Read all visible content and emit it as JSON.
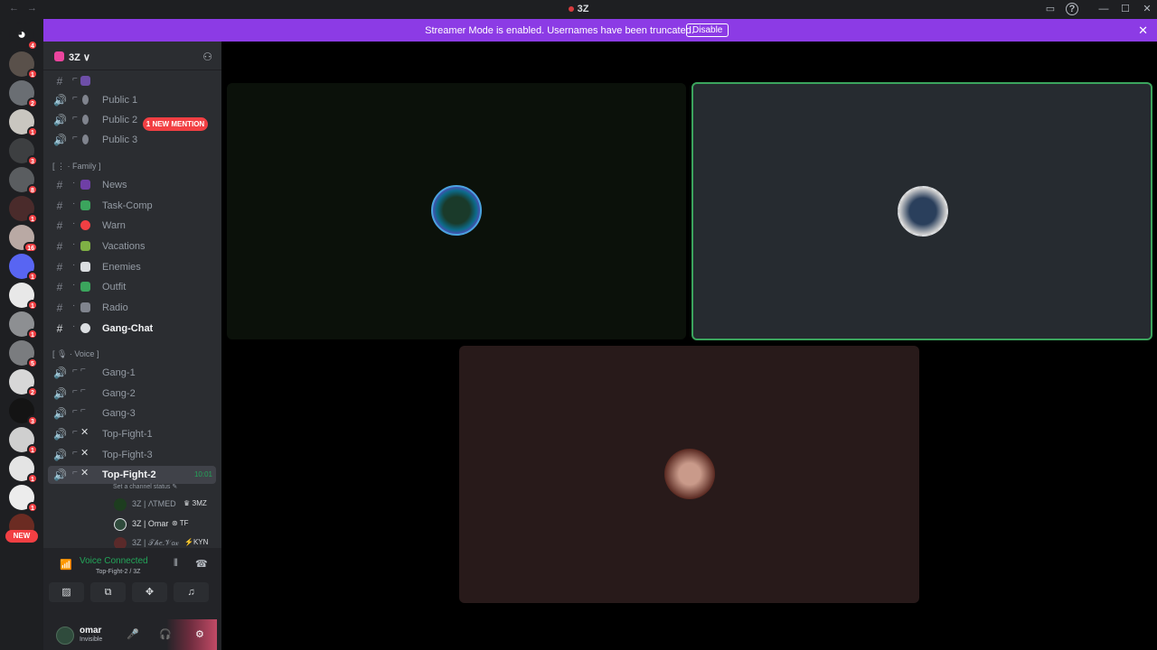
{
  "window": {
    "title": "3Z",
    "back": "←",
    "forward": "→",
    "inbox_glyph": "▭",
    "help_glyph": "?",
    "minimize_glyph": "—",
    "maximize_glyph": "☐",
    "close_glyph": "✕"
  },
  "guild_rail": {
    "home_glyph": "◕",
    "home_badge": "4",
    "new_label": "NEW",
    "badges": [
      "1",
      "2",
      "1",
      "3",
      "8",
      "1",
      "16",
      "1",
      "1",
      "1",
      "5",
      "2",
      "3",
      "1",
      "1",
      "1",
      "1"
    ]
  },
  "banner": {
    "text": "Streamer Mode is enabled. Usernames have been truncated.",
    "button": "Disable",
    "close_glyph": "✕"
  },
  "server": {
    "name": "3Z",
    "chevron": "∨",
    "invite_glyph": "⚇"
  },
  "mention_pill": "1 NEW MENTION",
  "channels": [
    {
      "icon": "#",
      "name": ""
    },
    {
      "icon": "🔊",
      "name": "Public 1"
    },
    {
      "icon": "🔊",
      "name": "Public 2"
    },
    {
      "icon": "🔊",
      "name": "Public 3"
    },
    {
      "icon": "#",
      "name": "News"
    },
    {
      "icon": "#",
      "name": "Task-Comp"
    },
    {
      "icon": "#",
      "name": "Warn"
    },
    {
      "icon": "#",
      "name": "Vacations"
    },
    {
      "icon": "#",
      "name": "Enemies"
    },
    {
      "icon": "#",
      "name": "Outfit"
    },
    {
      "icon": "#",
      "name": "Radio"
    },
    {
      "icon": "#",
      "name": "Gang-Chat"
    },
    {
      "icon": "🔊",
      "name": "Gang-1"
    },
    {
      "icon": "🔊",
      "name": "Gang-2"
    },
    {
      "icon": "🔊",
      "name": "Gang-3"
    },
    {
      "icon": "🔊",
      "name": "Top-Fight-1"
    },
    {
      "icon": "🔊",
      "name": "Top-Fight-3"
    },
    {
      "icon": "🔊",
      "name": "Top-Fight-2",
      "time": "10:01"
    }
  ],
  "categories": {
    "family": "[  ⋮ · Family ]",
    "voice": "[  🎙 · Voice ]"
  },
  "channel_status": "Set a channel status ✎",
  "voice_users": [
    {
      "name": "3Z | ΛΤMED",
      "tag": "♛ ЗMZ"
    },
    {
      "name": "3Z | Omar",
      "tag": "⊛ TF"
    },
    {
      "name": "3Z | 𝒯𝒽𝑒.𝒱𝑜𝓍",
      "tag": "⚡KYN"
    }
  ],
  "voice_panel": {
    "title": "Voice Connected",
    "subtitle": "Top-Fight-2 / 3Z",
    "signal_glyph": "📶",
    "wave_glyph": "⦀",
    "hangup_glyph": "☎",
    "btn_camera": "▨",
    "btn_screen": "⧉",
    "btn_activities": "✥",
    "btn_soundboard": "♫"
  },
  "user": {
    "name": "omar",
    "status": "Invisible",
    "mic_glyph": "🎤",
    "headset_glyph": "🎧",
    "settings_glyph": "⚙"
  },
  "colors": {
    "accent": "#8c3be5",
    "speaking": "#3ba55d",
    "tile_left": "#0b110a",
    "tile_right": "#262b30",
    "tile_bottom": "#281a1a"
  }
}
